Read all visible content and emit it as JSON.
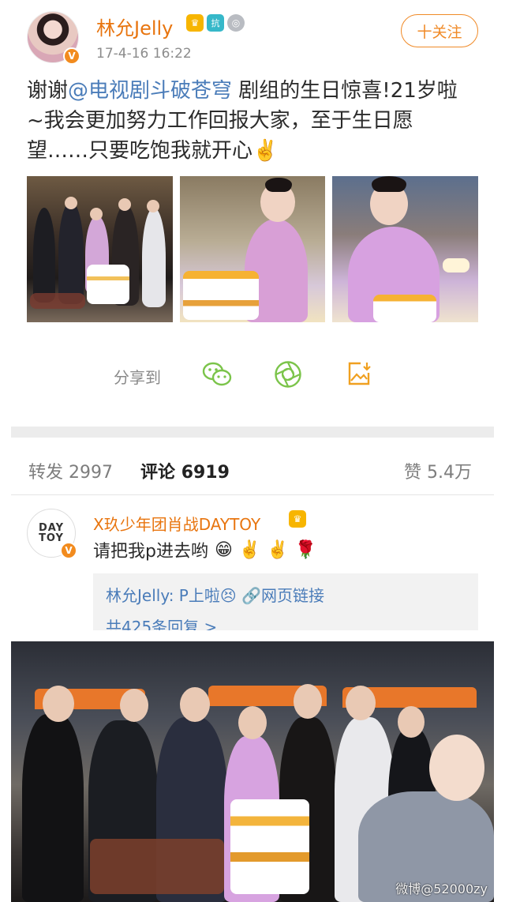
{
  "post": {
    "username": "林允Jelly",
    "avatar_verified_badge": "V",
    "badges": [
      {
        "name": "crown-badge-icon",
        "glyph": "♛"
      },
      {
        "name": "shield-badge-icon",
        "glyph": "抗"
      },
      {
        "name": "medal-badge-icon",
        "glyph": "◎"
      }
    ],
    "timestamp": "17-4-16 16:22",
    "follow_label": "十关注",
    "text_prefix": "谢谢",
    "mention": "@电视剧斗破苍穹",
    "text_rest": " 剧组的生日惊喜!21岁啦~我会更加努力工作回报大家，至于生日愿望……只要吃饱我就开心",
    "text_emoji": "✌️",
    "share_label": "分享到",
    "share_icons": [
      "wechat-icon",
      "moments-icon",
      "save-image-icon"
    ]
  },
  "tabs": {
    "repost_label": "转发",
    "repost_count": "2997",
    "comment_label": "评论",
    "comment_count": "6919",
    "like_label": "赞",
    "like_count": "5.4万"
  },
  "comment": {
    "avatar_text_line1": "DAY",
    "avatar_text_line2": "TOY",
    "avatar_verified_badge": "V",
    "username": "X玖少年团肖战DAYTOY",
    "crown_glyph": "♛",
    "text": "请把我p进去哟",
    "emojis": [
      "😁",
      "✌️",
      "✌️",
      "🌹"
    ],
    "reply": {
      "author": "林允Jelly:",
      "text": " P上啦",
      "emoji": "😣",
      "link_icon": "🔗",
      "link_text": "网页链接",
      "count_text": "共425条回复 >"
    }
  },
  "image_watermark": "微博@52000zy",
  "colors": {
    "orange": "#e8750f",
    "link_blue": "#4a7cb9",
    "follow_orange": "#f08a27",
    "share_green": "#7bc44a",
    "save_orange": "#f0a020"
  }
}
